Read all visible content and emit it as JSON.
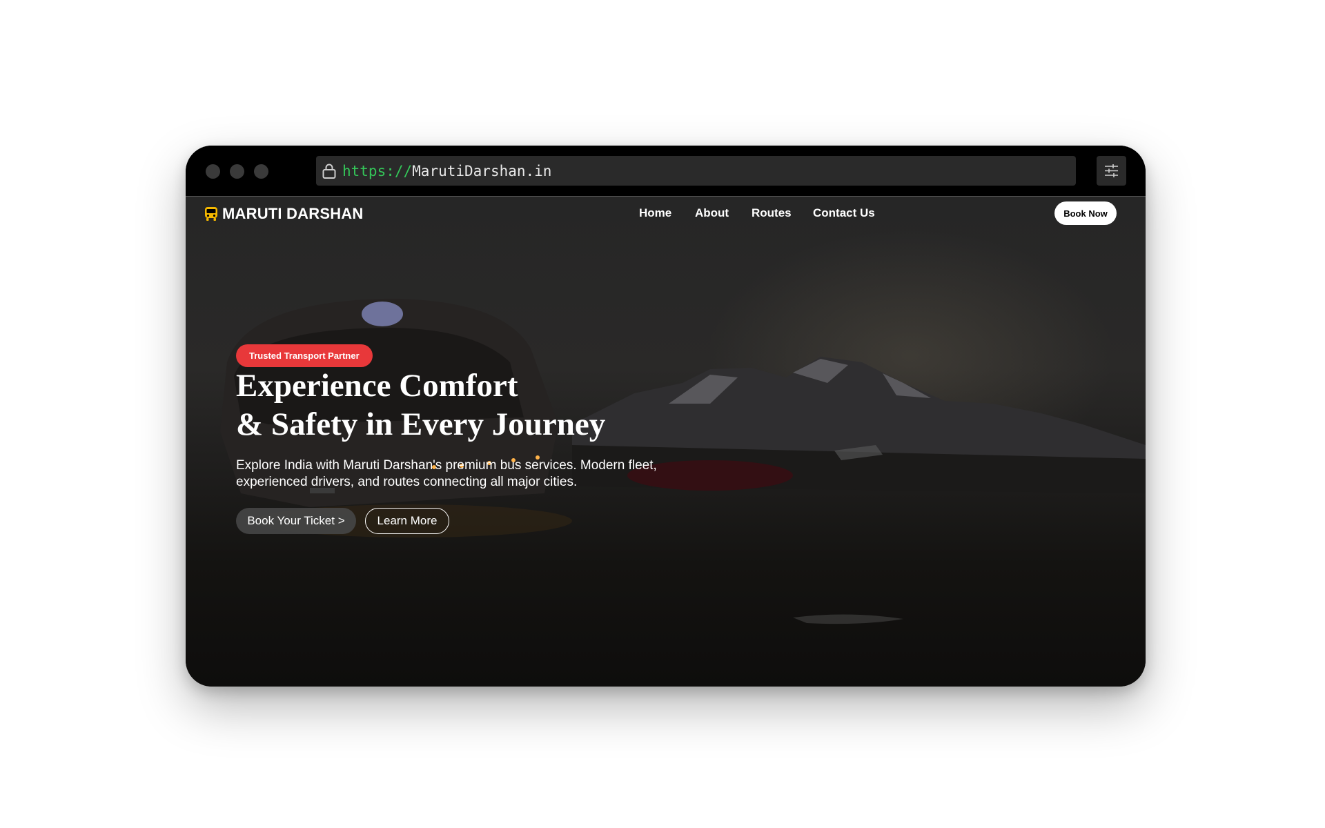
{
  "browser": {
    "url_scheme": "https://",
    "url_host": "MarutiDarshan.in",
    "lock_icon": "lock-icon",
    "menu_icon": "sliders-icon"
  },
  "nav": {
    "brand": "MARUTI DARSHAN",
    "brand_icon": "bus-icon",
    "brand_icon_color": "#f5b800",
    "links": [
      "Home",
      "About",
      "Routes",
      "Contact Us"
    ],
    "cta": "Book Now"
  },
  "hero": {
    "badge": "Trusted Transport Partner",
    "badge_color": "#e8383a",
    "headline_line1": "Experience Comfort",
    "headline_line2": "& Safety in Every Journey",
    "subtext": "Explore India with Maruti Darshan's premium bus services. Modern fleet, experienced drivers, and routes connecting all major cities.",
    "primary_button": "Book Your Ticket >",
    "secondary_button": "Learn More"
  }
}
